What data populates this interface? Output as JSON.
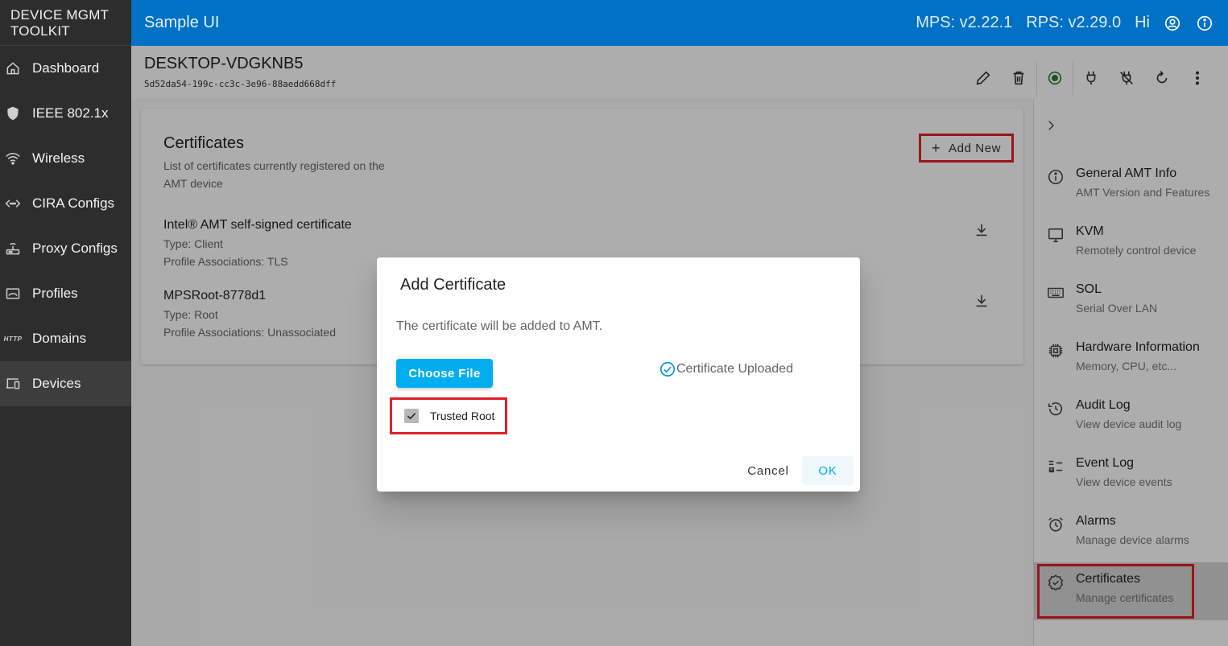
{
  "sidebar": {
    "brand": [
      "DEVICE MGMT",
      "TOOLKIT"
    ],
    "items": [
      {
        "label": "Dashboard",
        "icon": "home-icon"
      },
      {
        "label": "IEEE 802.1x",
        "icon": "shield-icon"
      },
      {
        "label": "Wireless",
        "icon": "wifi-icon"
      },
      {
        "label": "CIRA Configs",
        "icon": "code-arrows-icon"
      },
      {
        "label": "Proxy Configs",
        "icon": "router-icon"
      },
      {
        "label": "Profiles",
        "icon": "profile-icon"
      },
      {
        "label": "Domains",
        "icon_text": "HTTP"
      },
      {
        "label": "Devices",
        "icon": "devices-icon",
        "active": true
      }
    ]
  },
  "topbar": {
    "title": "Sample UI",
    "mps": "MPS: v2.22.1",
    "rps": "RPS: v2.29.0",
    "greeting": "Hi"
  },
  "device": {
    "name": "DESKTOP-VDGKNB5",
    "guid": "5d52da54-199c-cc3c-3e96-88aedd668dff"
  },
  "certificates": {
    "title": "Certificates",
    "subtitle": "List of certificates currently registered on the AMT device",
    "add_new": "Add New",
    "list": [
      {
        "name": "Intel® AMT self-signed certificate",
        "type": "Type: Client",
        "assoc": "Profile Associations: TLS"
      },
      {
        "name": "MPSRoot-8778d1",
        "type": "Type: Root",
        "assoc": "Profile Associations: Unassociated"
      }
    ]
  },
  "rightpanel": {
    "items": [
      {
        "title": "General AMT Info",
        "sub": "AMT Version and Features"
      },
      {
        "title": "KVM",
        "sub": "Remotely control device"
      },
      {
        "title": "SOL",
        "sub": "Serial Over LAN"
      },
      {
        "title": "Hardware Information",
        "sub": "Memory, CPU, etc..."
      },
      {
        "title": "Audit Log",
        "sub": "View device audit log"
      },
      {
        "title": "Event Log",
        "sub": "View device events"
      },
      {
        "title": "Alarms",
        "sub": "Manage device alarms"
      },
      {
        "title": "Certificates",
        "sub": "Manage certificates"
      }
    ]
  },
  "dialog": {
    "title": "Add Certificate",
    "message": "The certificate will be added to AMT.",
    "choose_file": "Choose File",
    "uploaded": "Certificate Uploaded",
    "trusted_root": "Trusted Root",
    "trusted_checked": true,
    "cancel": "Cancel",
    "ok": "OK"
  },
  "colors": {
    "topbar": "#0071c5",
    "sidebar": "#2d2d2d",
    "primary_button": "#00aeef",
    "highlight": "#e0202a"
  }
}
